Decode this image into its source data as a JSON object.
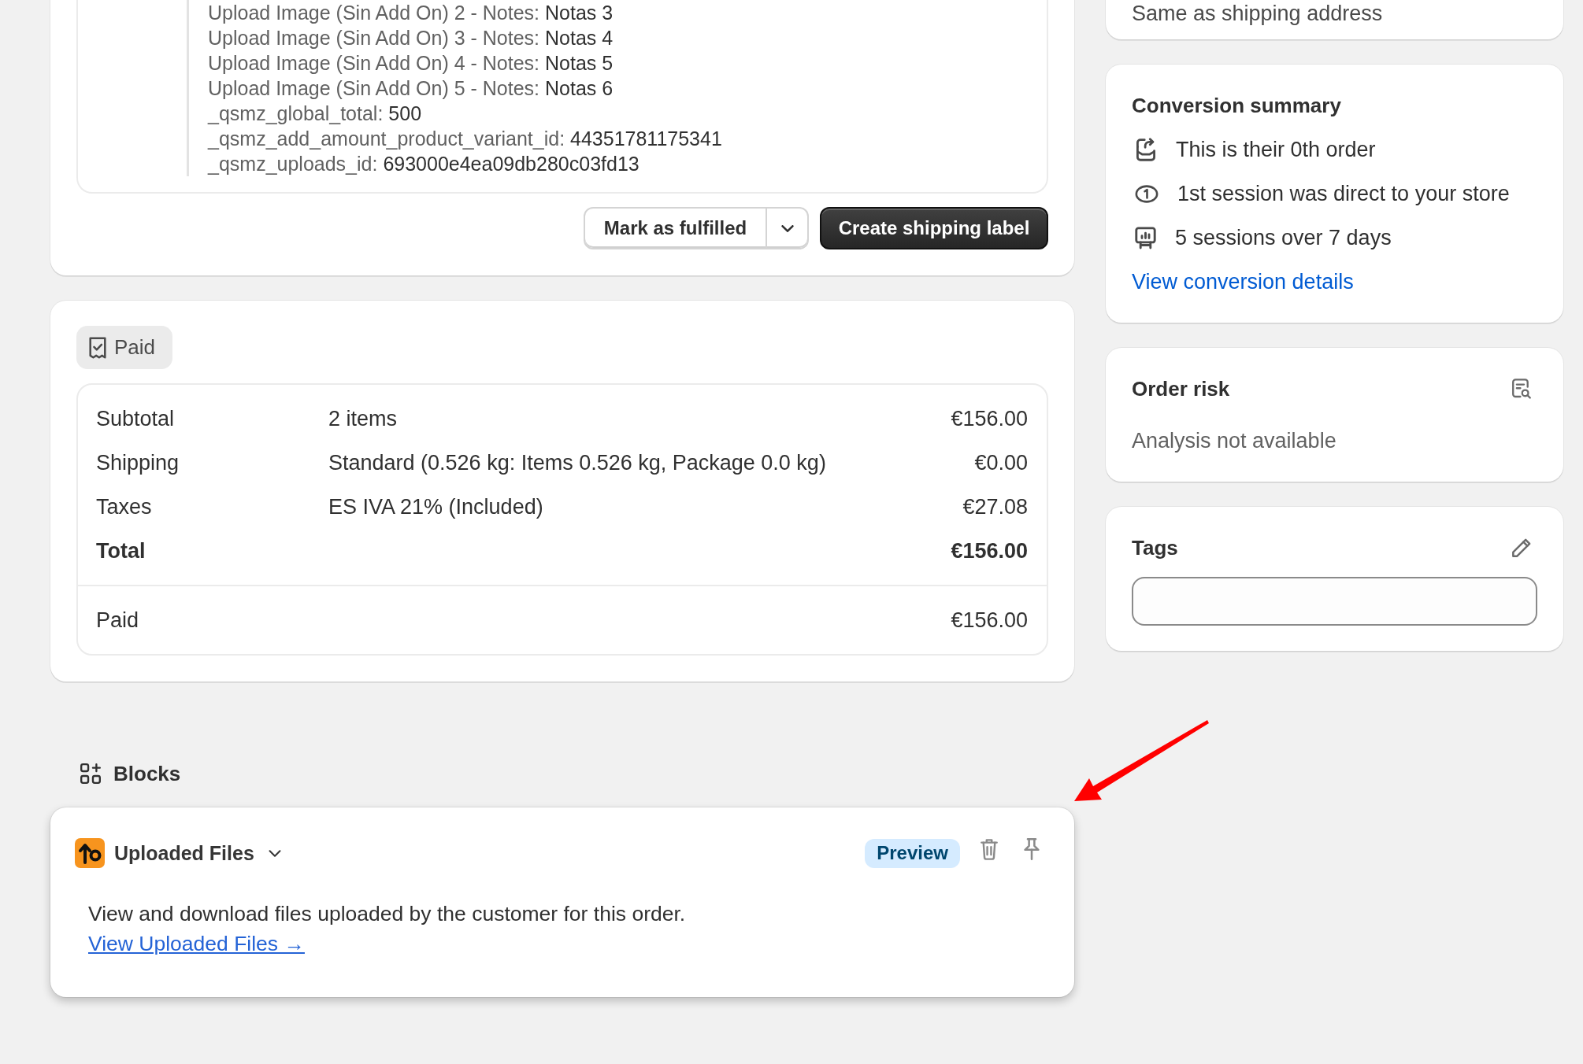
{
  "line_item": {
    "notes": [
      {
        "label": "Upload Image (Sin Add On) 2 - Notes:",
        "value": "Notas 3"
      },
      {
        "label": "Upload Image (Sin Add On) 3 - Notes:",
        "value": "Notas 4"
      },
      {
        "label": "Upload Image (Sin Add On) 4 - Notes:",
        "value": "Notas 5"
      },
      {
        "label": "Upload Image (Sin Add On) 5 - Notes:",
        "value": "Notas 6"
      },
      {
        "label": "_qsmz_global_total:",
        "value": "500"
      },
      {
        "label": "_qsmz_add_amount_product_variant_id:",
        "value": "44351781175341"
      },
      {
        "label": "_qsmz_uploads_id:",
        "value": "693000e4ea09db280c03fd13"
      }
    ],
    "actions": {
      "mark_fulfilled": "Mark as fulfilled",
      "create_label": "Create shipping label"
    }
  },
  "payment": {
    "status": "Paid",
    "rows": [
      {
        "kind": "line",
        "label": "Subtotal",
        "description": "2 items",
        "amount": "€156.00"
      },
      {
        "kind": "line",
        "label": "Shipping",
        "description": "Standard (0.526 kg: Items 0.526 kg, Package 0.0 kg)",
        "amount": "€0.00"
      },
      {
        "kind": "line",
        "label": "Taxes",
        "description": "ES IVA 21% (Included)",
        "amount": "€27.08"
      },
      {
        "kind": "total",
        "label": "Total",
        "amount": "€156.00"
      },
      {
        "kind": "paid",
        "label": "Paid",
        "amount": "€156.00"
      }
    ]
  },
  "blocks": {
    "title": "Blocks",
    "items": [
      {
        "title": "Uploaded Files",
        "badge": "Preview",
        "description": "View and download files uploaded by the customer for this order.",
        "link": "View Uploaded Files →"
      }
    ]
  },
  "sidebar": {
    "billing_address": {
      "text": "Same as shipping address"
    },
    "conversion_summary": {
      "title": "Conversion summary",
      "items": [
        {
          "kind": "order",
          "text": "This is their 0th order"
        },
        {
          "kind": "referral",
          "text": "1st session was direct to your store"
        },
        {
          "kind": "sessions",
          "text": "5 sessions over 7 days"
        }
      ],
      "link": "View conversion details"
    },
    "order_risk": {
      "title": "Order risk",
      "text": "Analysis not available"
    },
    "tags": {
      "title": "Tags"
    }
  },
  "annotations": [
    {
      "kind": "arrow"
    }
  ]
}
